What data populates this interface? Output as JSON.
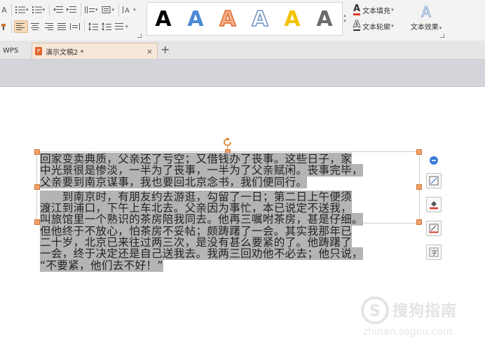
{
  "ribbon": {
    "style_letter": "A",
    "styles": [
      {
        "letter": "A",
        "fill": "#000000",
        "outline": "none"
      },
      {
        "letter": "A",
        "fill": "#4a8ad4",
        "outline": "none"
      },
      {
        "letter": "A",
        "fill": "#f3b08a",
        "outline": "#e06a2c"
      },
      {
        "letter": "A",
        "fill": "#ffffff",
        "outline": "#6d8fc4"
      },
      {
        "letter": "A",
        "fill": "#f5c200",
        "outline": "none"
      },
      {
        "letter": "A",
        "fill": "#6b6b6b",
        "outline": "none"
      }
    ],
    "text_fill_label": "文本填充",
    "text_outline_label": "文本轮廓",
    "text_effect_label": "文本效果",
    "effect_letter": "A",
    "partial_letter": "A"
  },
  "tabs": [
    {
      "label": "WPS",
      "active": false
    },
    {
      "label": "演示文稿2 *",
      "active": true
    }
  ],
  "tab_close": "×",
  "new_tab": "+",
  "text_box": {
    "para1": [
      "回家变卖典质，父亲还了亏空；又借钱办了丧事。这些日子，家",
      "中光景很是惨淡，一半为了丧事，一半为了父亲赋闲。丧事完毕，",
      "父亲要到南京谋事，我也要回北京念书，我们便同行。"
    ],
    "para2": [
      "　　到南京时，有朋友约去游逛，勾留了一日；第二日上午便须",
      "渡江到浦口，下午上车北去。父亲因为事忙，本已说定不送我，",
      "叫旅馆里一个熟识的茶房陪我同去。他再三嘱咐茶房，甚是仔细。",
      "但他终于不放心，怕茶房不妥帖；颇踌躇了一会。其实我那年已",
      "二十岁，北京已来往过两三次，是没有甚么要紧的了。他踌躇了",
      "一会，终于决定还是自己送我去。我两三回劝他不必去；他只说，",
      "“不要紧，他们去不好！”"
    ]
  },
  "watermark": {
    "text": "搜狗指南",
    "url": "zhinan.sogou.com"
  },
  "colors": {
    "selection": "#b4b4b4",
    "handle": "#f0a06a",
    "accent": "#e06a2c"
  }
}
